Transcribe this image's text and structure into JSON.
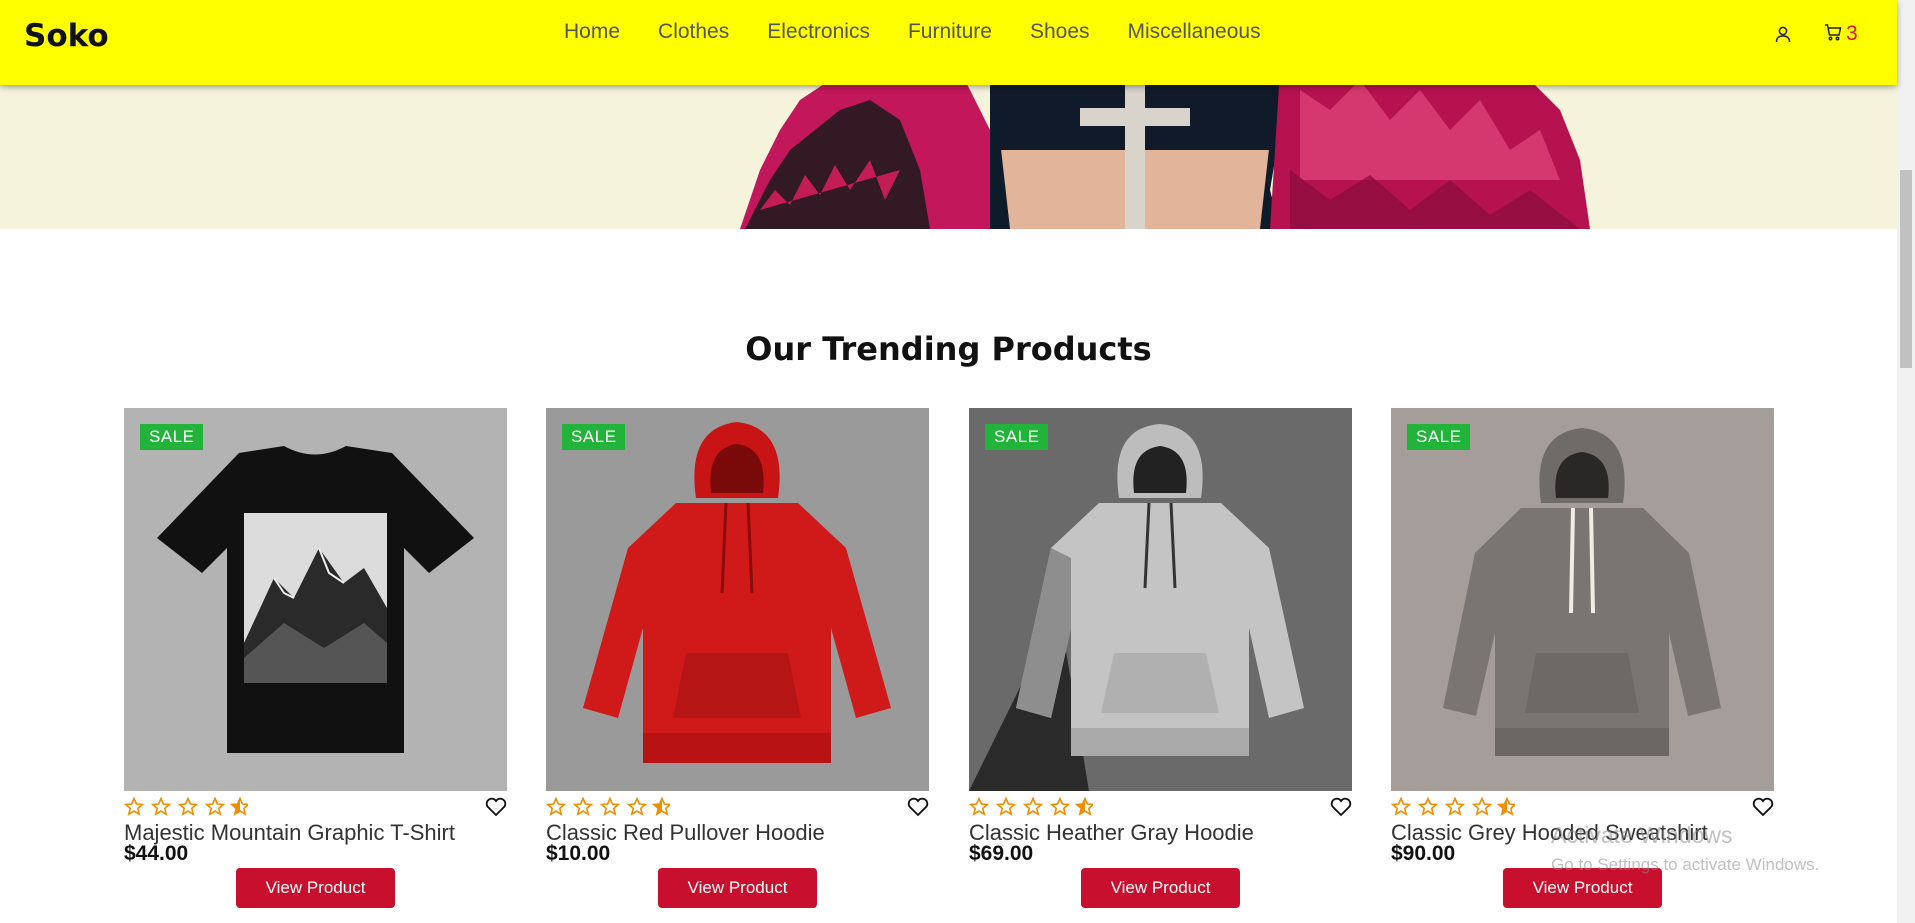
{
  "brand": {
    "name": "Soko"
  },
  "nav": {
    "links": [
      "Home",
      "Clothes",
      "Electronics",
      "Furniture",
      "Shoes",
      "Miscellaneous"
    ],
    "cart_count": "3",
    "icons": [
      "user-icon",
      "cart-icon"
    ]
  },
  "colors": {
    "nav_bg": "#ffff00",
    "sale_badge": "#22b33a",
    "button": "#c8102e",
    "star": "#f28c00",
    "cart_count": "#e0102a"
  },
  "section": {
    "title": "Our Trending Products"
  },
  "products": [
    {
      "badge": "SALE",
      "name": "Majestic Mountain Graphic T-Shirt",
      "price": "$44.00",
      "rating": 4.5,
      "button": "View Product"
    },
    {
      "badge": "SALE",
      "name": "Classic Red Pullover Hoodie",
      "price": "$10.00",
      "rating": 4.5,
      "button": "View Product"
    },
    {
      "badge": "SALE",
      "name": "Classic Heather Gray Hoodie",
      "price": "$69.00",
      "rating": 4.5,
      "button": "View Product"
    },
    {
      "badge": "SALE",
      "name": "Classic Grey Hooded Sweatshirt",
      "price": "$90.00",
      "rating": 4.5,
      "button": "View Product"
    }
  ],
  "watermark": {
    "title": "Activate Windows",
    "subtitle": "Go to Settings to activate Windows."
  }
}
